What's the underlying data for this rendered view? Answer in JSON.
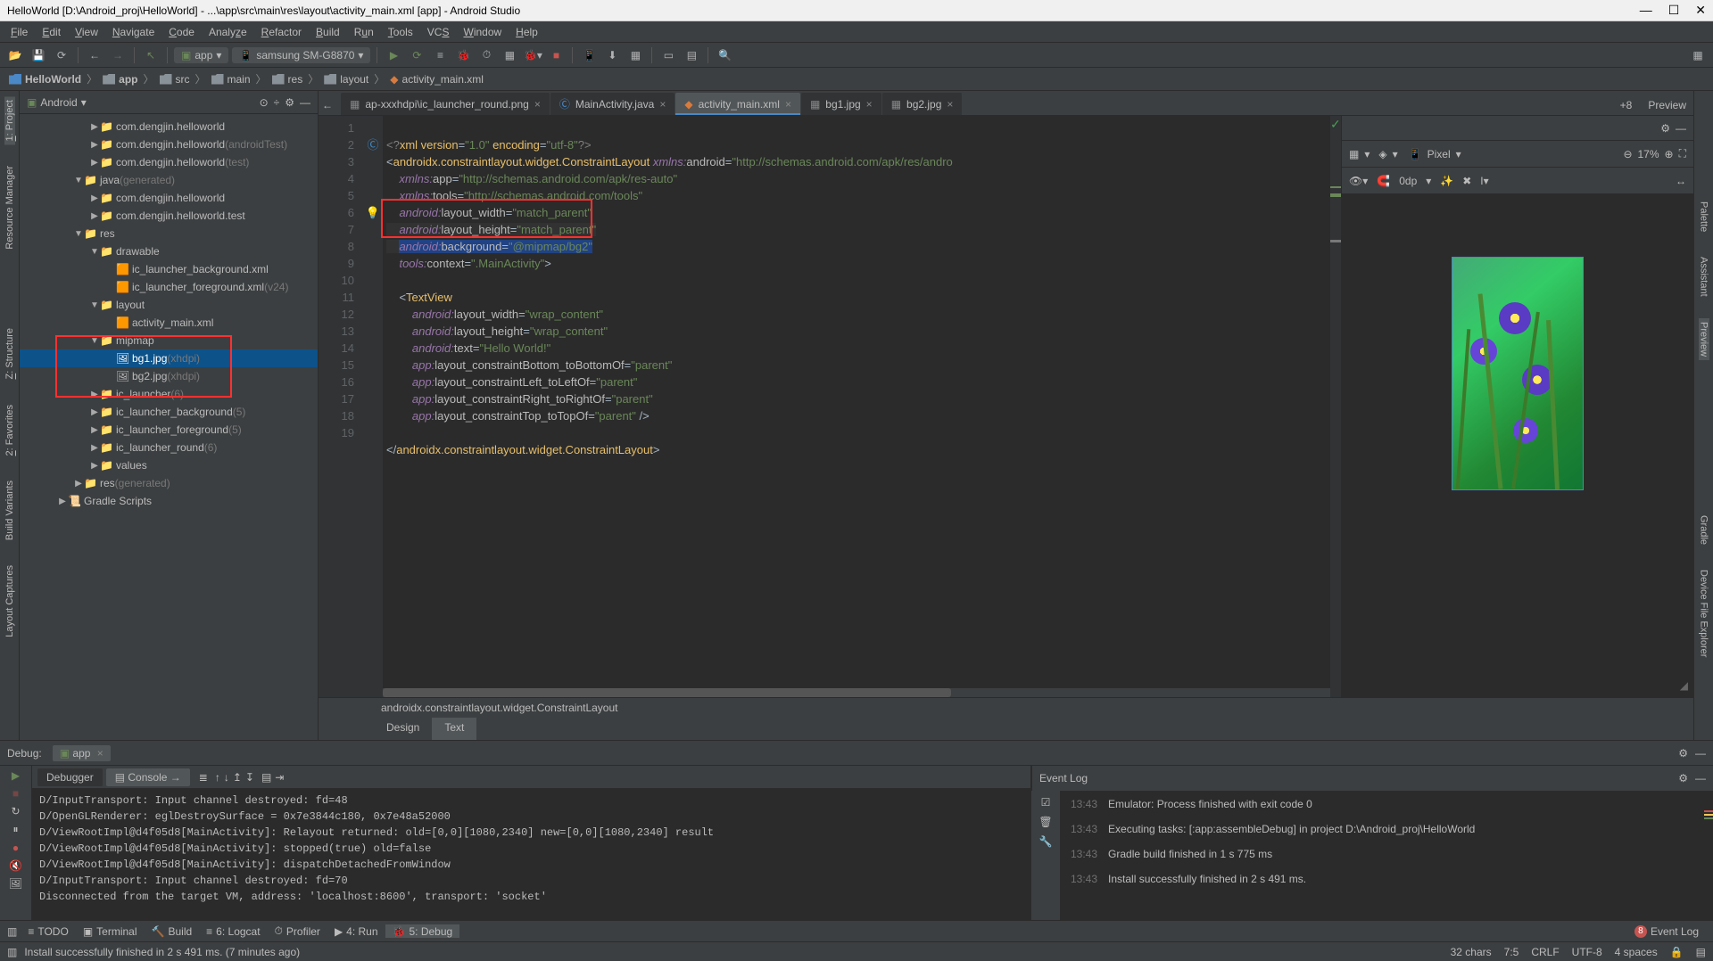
{
  "window_title": "HelloWorld [D:\\Android_proj\\HelloWorld] - ...\\app\\src\\main\\res\\layout\\activity_main.xml [app] - Android Studio",
  "menus": [
    "File",
    "Edit",
    "View",
    "Navigate",
    "Code",
    "Analyze",
    "Refactor",
    "Build",
    "Run",
    "Tools",
    "VCS",
    "Window",
    "Help"
  ],
  "run_config": "app",
  "device": "samsung SM-G8870",
  "breadcrumb": [
    "HelloWorld",
    "app",
    "src",
    "main",
    "res",
    "layout",
    "activity_main.xml"
  ],
  "left_panels": [
    "1: Project",
    "Resource Manager"
  ],
  "left_panels2": [
    "Z: Structure",
    "2: Favorites",
    "Build Variants",
    "Layout Captures"
  ],
  "right_panels": [
    "Palette",
    "Assistant",
    "Preview",
    "Gradle",
    "Device File Explorer"
  ],
  "project": {
    "root_label": "Android",
    "items": [
      {
        "indent": 1,
        "arrow": "▶",
        "icon": "📁",
        "label": "com.dengjin.helloworld"
      },
      {
        "indent": 1,
        "arrow": "▶",
        "icon": "📁",
        "label": "com.dengjin.helloworld",
        "suffix": "(androidTest)"
      },
      {
        "indent": 1,
        "arrow": "▶",
        "icon": "📁",
        "label": "com.dengjin.helloworld",
        "suffix": "(test)"
      },
      {
        "indent": 0,
        "arrow": "▼",
        "icon": "📁",
        "label": "java",
        "suffix": "(generated)"
      },
      {
        "indent": 1,
        "arrow": "▶",
        "icon": "📁",
        "label": "com.dengjin.helloworld"
      },
      {
        "indent": 1,
        "arrow": "▶",
        "icon": "📁",
        "label": "com.dengjin.helloworld.test"
      },
      {
        "indent": 0,
        "arrow": "▼",
        "icon": "📁",
        "label": "res"
      },
      {
        "indent": 1,
        "arrow": "▼",
        "icon": "📁",
        "label": "drawable"
      },
      {
        "indent": 2,
        "arrow": "",
        "icon": "🟧",
        "label": "ic_launcher_background.xml"
      },
      {
        "indent": 2,
        "arrow": "",
        "icon": "🟧",
        "label": "ic_launcher_foreground.xml",
        "suffix": "(v24)"
      },
      {
        "indent": 1,
        "arrow": "▼",
        "icon": "📁",
        "label": "layout"
      },
      {
        "indent": 2,
        "arrow": "",
        "icon": "🟧",
        "label": "activity_main.xml"
      },
      {
        "indent": 1,
        "arrow": "▼",
        "icon": "📁",
        "label": "mipmap"
      },
      {
        "indent": 2,
        "arrow": "",
        "icon": "🖼",
        "label": "bg1.jpg",
        "suffix": "(xhdpi)",
        "selected": true
      },
      {
        "indent": 2,
        "arrow": "",
        "icon": "🖼",
        "label": "bg2.jpg",
        "suffix": "(xhdpi)"
      },
      {
        "indent": 1,
        "arrow": "▶",
        "icon": "📁",
        "label": "ic_launcher",
        "suffix": "(6)"
      },
      {
        "indent": 1,
        "arrow": "▶",
        "icon": "📁",
        "label": "ic_launcher_background",
        "suffix": "(5)"
      },
      {
        "indent": 1,
        "arrow": "▶",
        "icon": "📁",
        "label": "ic_launcher_foreground",
        "suffix": "(5)"
      },
      {
        "indent": 1,
        "arrow": "▶",
        "icon": "📁",
        "label": "ic_launcher_round",
        "suffix": "(6)"
      },
      {
        "indent": 1,
        "arrow": "▶",
        "icon": "📁",
        "label": "values"
      },
      {
        "indent": 0,
        "arrow": "▶",
        "icon": "📁",
        "label": "res",
        "suffix": "(generated)"
      },
      {
        "indent": -1,
        "arrow": "▶",
        "icon": "📜",
        "label": "Gradle Scripts"
      }
    ]
  },
  "tabs": [
    {
      "label": "ap-xxxhdpi\\ic_launcher_round.png",
      "active": false,
      "kind": "img"
    },
    {
      "label": "MainActivity.java",
      "active": false,
      "kind": "java"
    },
    {
      "label": "activity_main.xml",
      "active": true,
      "kind": "xml"
    },
    {
      "label": "bg1.jpg",
      "active": false,
      "kind": "img"
    },
    {
      "label": "bg2.jpg",
      "active": false,
      "kind": "img"
    }
  ],
  "more_tabs": "+8",
  "preview_label": "Preview",
  "code_lines_start": 1,
  "code_lines_end": 19,
  "code_crumb": "androidx.constraintlayout.widget.ConstraintLayout",
  "footer_tabs": {
    "design": "Design",
    "text": "Text"
  },
  "debug": {
    "label": "Debug:",
    "app": "app"
  },
  "eventlog_title": "Event Log",
  "debugger_tabs": {
    "debugger": "Debugger",
    "console": "Console"
  },
  "console_lines": [
    "D/InputTransport: Input channel destroyed: fd=48",
    "D/OpenGLRenderer: eglDestroySurface = 0x7e3844c180, 0x7e48a52000",
    "D/ViewRootImpl@d4f05d8[MainActivity]: Relayout returned: old=[0,0][1080,2340] new=[0,0][1080,2340] result",
    "D/ViewRootImpl@d4f05d8[MainActivity]: stopped(true) old=false",
    "D/ViewRootImpl@d4f05d8[MainActivity]: dispatchDetachedFromWindow",
    "D/InputTransport: Input channel destroyed: fd=70",
    "Disconnected from the target VM, address: 'localhost:8600', transport: 'socket'"
  ],
  "events": [
    {
      "ts": "13:43",
      "msg": "Emulator: Process finished with exit code 0"
    },
    {
      "ts": "13:43",
      "msg": "Executing tasks: [:app:assembleDebug] in project D:\\Android_proj\\HelloWorld"
    },
    {
      "ts": "13:43",
      "msg": "Gradle build finished in 1 s 775 ms"
    },
    {
      "ts": "13:43",
      "msg": "Install successfully finished in 2 s 491 ms."
    }
  ],
  "bottom": [
    {
      "icon": "≡",
      "label": "TODO"
    },
    {
      "icon": "▣",
      "label": "Terminal"
    },
    {
      "icon": "🔨",
      "label": "Build"
    },
    {
      "icon": "≡",
      "label": "6: Logcat"
    },
    {
      "icon": "⏱",
      "label": "Profiler"
    },
    {
      "icon": "▶",
      "label": "4: Run"
    },
    {
      "icon": "🐞",
      "label": "5: Debug",
      "active": true
    }
  ],
  "bottom_right": {
    "badge": "8",
    "label": "Event Log"
  },
  "status": {
    "msg": "Install successfully finished in 2 s 491 ms. (7 minutes ago)",
    "chars": "32 chars",
    "pos": "7:5",
    "eol": "CRLF",
    "enc": "UTF-8",
    "indent": "4 spaces"
  },
  "preview_ctrl": {
    "device": "Pixel",
    "zoom": "17%",
    "dp": "0dp"
  }
}
